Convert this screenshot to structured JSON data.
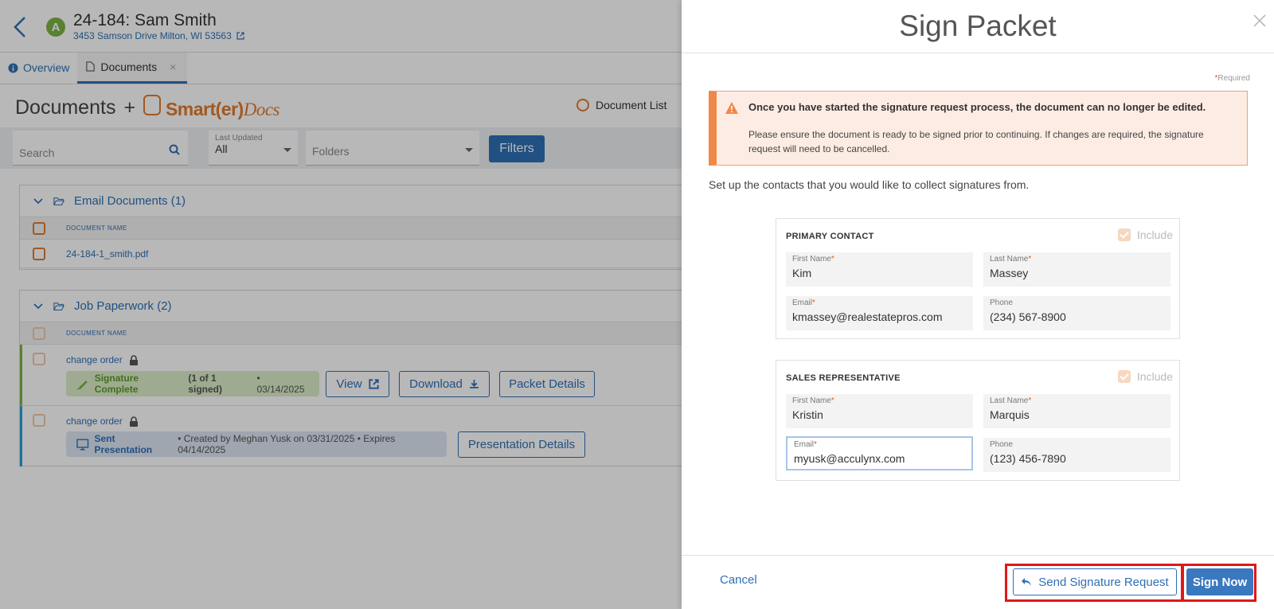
{
  "job": {
    "avatar_letter": "A",
    "title": "24-184: Sam Smith",
    "address": "3453 Samson Drive Milton, WI 53563"
  },
  "tabs": [
    {
      "label": "Overview"
    },
    {
      "label": "Documents",
      "close": "×"
    }
  ],
  "documents": {
    "title": "Documents",
    "plus": "+",
    "brand": "Smart(er)",
    "brand_italic": "Docs",
    "view_option": "Document List"
  },
  "filters": {
    "search_placeholder": "Search",
    "last_updated_label": "Last Updated",
    "last_updated_value": "All",
    "folders_placeholder": "Folders",
    "filters_button": "Filters"
  },
  "groups": [
    {
      "name": "Email Documents (1)",
      "column": "DOCUMENT NAME",
      "rows": [
        {
          "name": "24-184-1_smith.pdf"
        }
      ]
    },
    {
      "name": "Job Paperwork (2)",
      "column": "DOCUMENT NAME",
      "rows": [
        {
          "name": "change order",
          "status": "Signature Complete",
          "status_detail": "(1 of 1 signed)",
          "status_date": "• 03/14/2025",
          "buttons": [
            "View",
            "Download",
            "Packet Details"
          ]
        },
        {
          "name": "change order",
          "status": "Sent Presentation",
          "status_detail": "• Created by Meghan Yusk on 03/31/2025 • Expires 04/14/2025",
          "buttons": [
            "Presentation Details"
          ]
        }
      ]
    }
  ],
  "drawer": {
    "title": "Sign Packet",
    "required_star": "*",
    "required_label": "Required",
    "warning_title": "Once you have started the signature request process, the document can no longer be edited.",
    "warning_body": "Please ensure the document is ready to be signed prior to continuing. If changes are required, the signature request will need to be cancelled.",
    "intro": "Set up the contacts that you would like to collect signatures from.",
    "contacts": [
      {
        "heading": "PRIMARY CONTACT",
        "include_label": "Include",
        "first_name_label": "First Name",
        "first_name": "Kim",
        "last_name_label": "Last Name",
        "last_name": "Massey",
        "email_label": "Email",
        "email": "kmassey@realestatepros.com",
        "phone_label": "Phone",
        "phone": "(234) 567-8900"
      },
      {
        "heading": "SALES REPRESENTATIVE",
        "include_label": "Include",
        "first_name_label": "First Name",
        "first_name": "Kristin",
        "last_name_label": "Last Name",
        "last_name": "Marquis",
        "email_label": "Email",
        "email": "myusk@acculynx.com",
        "phone_label": "Phone",
        "phone": "(123) 456-7890"
      }
    ],
    "cancel": "Cancel",
    "send_request": "Send Signature Request",
    "sign_now": "Sign Now"
  },
  "colors": {
    "primary": "#2f6fb5",
    "brand_orange": "#e07b2e",
    "highlight_red": "#e01818",
    "success_green": "#7cb342"
  }
}
